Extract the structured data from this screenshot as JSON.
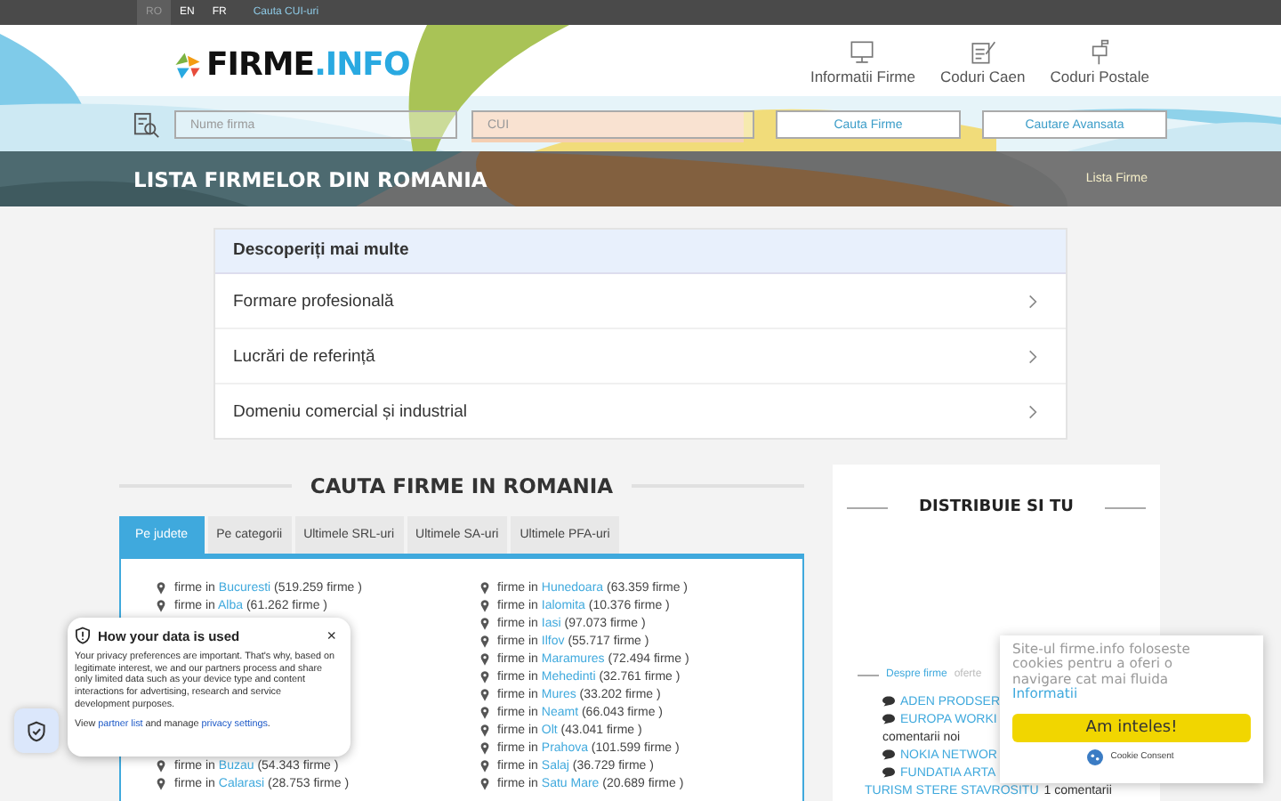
{
  "top_bar": {
    "languages": [
      {
        "label": "RO",
        "selected": true
      },
      {
        "label": "EN",
        "selected": false
      },
      {
        "label": "FR",
        "selected": false
      }
    ],
    "link": "Cauta CUI-uri"
  },
  "header": {
    "logo_dark": "FIRME",
    "logo_accent": ".INFO",
    "nav": [
      {
        "label": "Informatii Firme"
      },
      {
        "label": "Coduri Caen"
      },
      {
        "label": "Coduri Postale"
      }
    ],
    "search": {
      "fields": [
        {
          "placeholder": "Nume firma"
        },
        {
          "placeholder": "CUI"
        }
      ],
      "buttons": [
        "Cauta Firme",
        "Cautare Avansata"
      ]
    }
  },
  "banner": {
    "title": "LISTA FIRMELOR DIN ROMANIA",
    "breadcrumb": "Lista Firme"
  },
  "discover": {
    "title": "Descoperiți mai multe",
    "items": [
      "Formare profesională",
      "Lucrări de referință",
      "Domeniu comercial și industrial"
    ]
  },
  "search_section": {
    "title": "CAUTA FIRME IN ROMANIA",
    "tabs": [
      {
        "label": "Pe judete",
        "selected": true
      },
      {
        "label": "Pe categorii",
        "selected": false
      },
      {
        "label": "Ultimele SRL-uri",
        "selected": false
      },
      {
        "label": "Ultimele SA-uri",
        "selected": false
      },
      {
        "label": "Ultimele PFA-uri",
        "selected": false
      }
    ],
    "left_column_top": [
      {
        "prefix": "firme in",
        "county": "Bucuresti",
        "count": "(519.259 firme )"
      },
      {
        "prefix": "firme in",
        "county": "Alba",
        "count": "(61.262 firme )"
      }
    ],
    "left_column_bottom": [
      {
        "prefix": "firme in",
        "county": "Buzau",
        "count": "(54.343 firme )"
      },
      {
        "prefix": "firme in",
        "county": "Calarasi",
        "count": "(28.753 firme )"
      }
    ],
    "right_column": [
      {
        "prefix": "firme in",
        "county": "Hunedoara",
        "count": "(63.359 firme )"
      },
      {
        "prefix": "firme in",
        "county": "Ialomita",
        "count": "(10.376 firme )"
      },
      {
        "prefix": "firme in",
        "county": "Iasi",
        "count": "(97.073 firme )"
      },
      {
        "prefix": "firme in",
        "county": "Ilfov",
        "count": "(55.717 firme )"
      },
      {
        "prefix": "firme in",
        "county": "Maramures",
        "count": "(72.494 firme )"
      },
      {
        "prefix": "firme in",
        "county": "Mehedinti",
        "count": "(32.761 firme )"
      },
      {
        "prefix": "firme in",
        "county": "Mures",
        "count": "(33.202 firme )"
      },
      {
        "prefix": "firme in",
        "county": "Neamt",
        "count": "(66.043 firme )"
      },
      {
        "prefix": "firme in",
        "county": "Olt",
        "count": "(43.041 firme )"
      },
      {
        "prefix": "firme in",
        "county": "Prahova",
        "count": "(101.599 firme )"
      },
      {
        "prefix": "firme in",
        "county": "Salaj",
        "count": "(36.729 firme )"
      },
      {
        "prefix": "firme in",
        "county": "Satu Mare",
        "count": "(20.689 firme )"
      }
    ]
  },
  "share_panel": {
    "title": "DISTRIBUIE SI TU",
    "tabs": [
      {
        "label": "Despre firme",
        "selected": true
      },
      {
        "label": "oferte",
        "selected": false
      }
    ],
    "comments": [
      {
        "kind": "title",
        "text": "ADEN PRODSER"
      },
      {
        "kind": "title",
        "text": "EUROPA WORKI"
      },
      {
        "kind": "note",
        "text": "comentarii noi"
      },
      {
        "kind": "title",
        "text": "NOKIA NETWOR"
      },
      {
        "kind": "title",
        "text": "FUNDATIA ARTA"
      },
      {
        "kind": "link_note",
        "text": "TURISM STERE STAVROSITU",
        "note": "1 comentarii"
      }
    ]
  },
  "privacy_popup": {
    "title": "How your data is used",
    "close": "×",
    "body": "Your privacy preferences are important. That's why, based on legitimate interest, we and our partners process and share only limited data such as your device type and content interactions for advertising, research and service development purposes.",
    "footer": {
      "before": "View",
      "link_1": "partner list",
      "middle": "and manage",
      "link_2": "privacy settings",
      "after": "."
    }
  },
  "cookie_popup": {
    "message": "Site-ul firme.info foloseste cookies pentru a oferi o navigare cat mai fluida",
    "link": "Informatii",
    "button": "Am inteles!",
    "brand": "Cookie Consent"
  }
}
